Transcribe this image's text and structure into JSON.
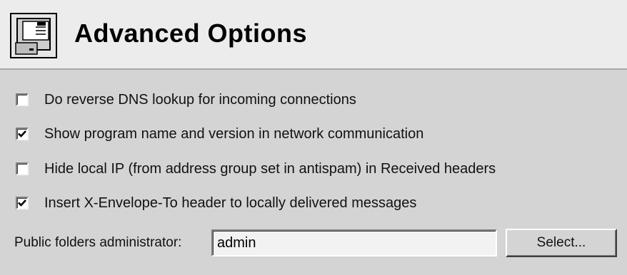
{
  "header": {
    "title": "Advanced Options",
    "icon": "panel-window-icon"
  },
  "options": [
    {
      "label": "Do reverse DNS lookup for incoming connections",
      "checked": false
    },
    {
      "label": "Show program name and version in network communication",
      "checked": true
    },
    {
      "label": "Hide local IP (from address group set in antispam) in Received headers",
      "checked": false
    },
    {
      "label": "Insert X-Envelope-To header to locally delivered messages",
      "checked": true
    }
  ],
  "public_folders": {
    "label": "Public folders administrator:",
    "value": "admin",
    "button_label": "Select..."
  },
  "colors": {
    "panel_bg": "#d4d4d4",
    "header_bg": "#ececec",
    "check_mark": "#000000"
  }
}
